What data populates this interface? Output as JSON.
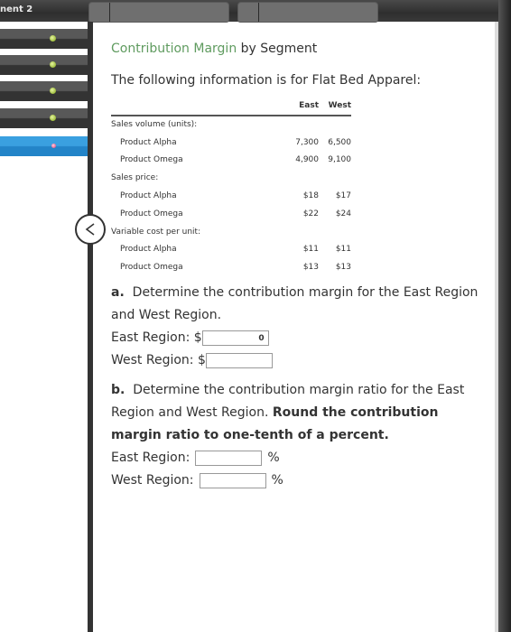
{
  "header": {
    "title_fragment": "nent 2",
    "tabs": [
      {
        "label": ""
      },
      {
        "label": ""
      }
    ]
  },
  "sidebar": {
    "items": [
      {
        "status": "complete",
        "icon": "green-dot-icon"
      },
      {
        "status": "complete",
        "icon": "green-dot-icon"
      },
      {
        "status": "complete",
        "icon": "green-dot-icon"
      },
      {
        "status": "complete",
        "icon": "green-dot-icon"
      },
      {
        "status": "incorrect",
        "icon": "pink-x-icon",
        "active": true
      }
    ],
    "collapse_icon": "chevron-left-icon"
  },
  "problem": {
    "title_highlight": "Contribution Margin",
    "title_rest": " by Segment",
    "intro": "The following information is for Flat Bed Apparel:",
    "table": {
      "columns": [
        "East",
        "West"
      ],
      "rows": [
        {
          "label": "Sales volume (units):",
          "indent": false,
          "east": "",
          "west": ""
        },
        {
          "label": "Product Alpha",
          "indent": true,
          "east": "7,300",
          "west": "6,500"
        },
        {
          "label": "Product Omega",
          "indent": true,
          "east": "4,900",
          "west": "9,100"
        },
        {
          "label": "Sales price:",
          "indent": false,
          "east": "",
          "west": ""
        },
        {
          "label": "Product Alpha",
          "indent": true,
          "east": "$18",
          "west": "$17"
        },
        {
          "label": "Product Omega",
          "indent": true,
          "east": "$22",
          "west": "$24"
        },
        {
          "label": "Variable cost per unit:",
          "indent": false,
          "east": "",
          "west": ""
        },
        {
          "label": "Product Alpha",
          "indent": true,
          "east": "$11",
          "west": "$11"
        },
        {
          "label": "Product Omega",
          "indent": true,
          "east": "$13",
          "west": "$13"
        }
      ]
    },
    "part_a": {
      "letter": "a.",
      "text": "Determine the contribution margin for the East Region and West Region.",
      "east_label": "East Region: $",
      "east_value": "0",
      "west_label": "West Region: $",
      "west_value": ""
    },
    "part_b": {
      "letter": "b.",
      "text": "Determine the contribution margin ratio for the East Region and West Region.",
      "bold_text": "Round the contribution margin ratio to one-tenth of a percent.",
      "east_label": "East Region:",
      "east_value": "",
      "west_label": "West Region:",
      "west_value": "",
      "unit": "%"
    }
  }
}
